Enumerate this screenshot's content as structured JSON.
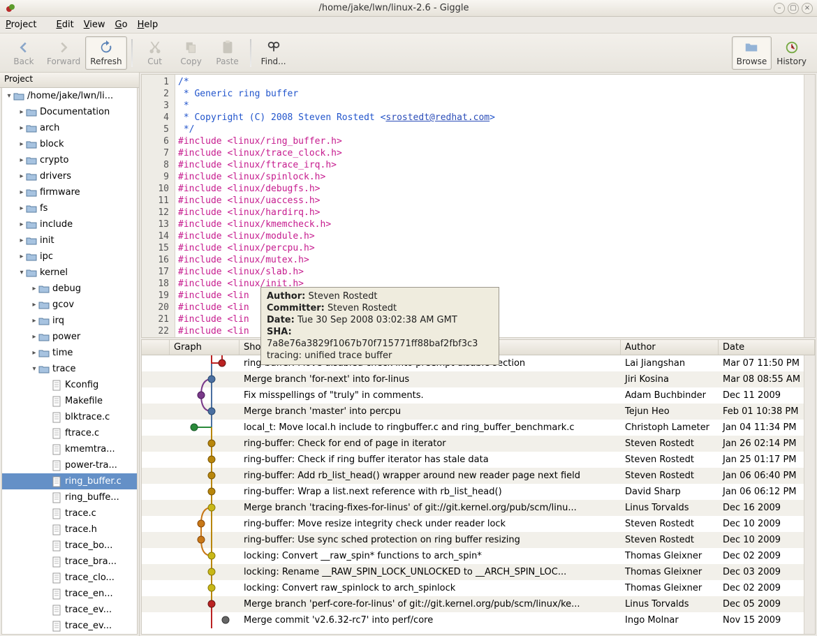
{
  "window": {
    "title": "/home/jake/lwn/linux-2.6 - Giggle"
  },
  "menu": {
    "project": "Project",
    "edit": "Edit",
    "view": "View",
    "go": "Go",
    "help": "Help"
  },
  "toolbar": {
    "back": "Back",
    "forward": "Forward",
    "refresh": "Refresh",
    "cut": "Cut",
    "copy": "Copy",
    "paste": "Paste",
    "find": "Find...",
    "browse": "Browse",
    "history": "History"
  },
  "sidebar": {
    "header": "Project",
    "tree": [
      {
        "depth": 0,
        "exp": "▾",
        "icon": "folder",
        "label": "/home/jake/lwn/li..."
      },
      {
        "depth": 1,
        "exp": "▸",
        "icon": "folder",
        "label": "Documentation"
      },
      {
        "depth": 1,
        "exp": "▸",
        "icon": "folder",
        "label": "arch"
      },
      {
        "depth": 1,
        "exp": "▸",
        "icon": "folder",
        "label": "block"
      },
      {
        "depth": 1,
        "exp": "▸",
        "icon": "folder",
        "label": "crypto"
      },
      {
        "depth": 1,
        "exp": "▸",
        "icon": "folder",
        "label": "drivers"
      },
      {
        "depth": 1,
        "exp": "▸",
        "icon": "folder",
        "label": "firmware"
      },
      {
        "depth": 1,
        "exp": "▸",
        "icon": "folder",
        "label": "fs"
      },
      {
        "depth": 1,
        "exp": "▸",
        "icon": "folder",
        "label": "include"
      },
      {
        "depth": 1,
        "exp": "▸",
        "icon": "folder",
        "label": "init"
      },
      {
        "depth": 1,
        "exp": "▸",
        "icon": "folder",
        "label": "ipc"
      },
      {
        "depth": 1,
        "exp": "▾",
        "icon": "folder",
        "label": "kernel"
      },
      {
        "depth": 2,
        "exp": "▸",
        "icon": "folder",
        "label": "debug"
      },
      {
        "depth": 2,
        "exp": "▸",
        "icon": "folder",
        "label": "gcov"
      },
      {
        "depth": 2,
        "exp": "▸",
        "icon": "folder",
        "label": "irq"
      },
      {
        "depth": 2,
        "exp": "▸",
        "icon": "folder",
        "label": "power"
      },
      {
        "depth": 2,
        "exp": "▸",
        "icon": "folder",
        "label": "time"
      },
      {
        "depth": 2,
        "exp": "▾",
        "icon": "folder",
        "label": "trace"
      },
      {
        "depth": 3,
        "exp": "",
        "icon": "file",
        "label": "Kconfig"
      },
      {
        "depth": 3,
        "exp": "",
        "icon": "file",
        "label": "Makefile"
      },
      {
        "depth": 3,
        "exp": "",
        "icon": "file",
        "label": "blktrace.c"
      },
      {
        "depth": 3,
        "exp": "",
        "icon": "file",
        "label": "ftrace.c"
      },
      {
        "depth": 3,
        "exp": "",
        "icon": "file",
        "label": "kmemtra..."
      },
      {
        "depth": 3,
        "exp": "",
        "icon": "file",
        "label": "power-tra..."
      },
      {
        "depth": 3,
        "exp": "",
        "icon": "file",
        "label": "ring_buffer.c",
        "selected": true
      },
      {
        "depth": 3,
        "exp": "",
        "icon": "file",
        "label": "ring_buffe..."
      },
      {
        "depth": 3,
        "exp": "",
        "icon": "file",
        "label": "trace.c"
      },
      {
        "depth": 3,
        "exp": "",
        "icon": "file",
        "label": "trace.h"
      },
      {
        "depth": 3,
        "exp": "",
        "icon": "file",
        "label": "trace_bo..."
      },
      {
        "depth": 3,
        "exp": "",
        "icon": "file",
        "label": "trace_bra..."
      },
      {
        "depth": 3,
        "exp": "",
        "icon": "file",
        "label": "trace_clo..."
      },
      {
        "depth": 3,
        "exp": "",
        "icon": "file",
        "label": "trace_en..."
      },
      {
        "depth": 3,
        "exp": "",
        "icon": "file",
        "label": "trace_ev..."
      },
      {
        "depth": 3,
        "exp": "",
        "icon": "file",
        "label": "trace_ev..."
      }
    ]
  },
  "code": {
    "lines": [
      {
        "n": 1,
        "cls": "tok-comment",
        "t": "/*"
      },
      {
        "n": 2,
        "cls": "tok-comment",
        "t": " * Generic ring buffer"
      },
      {
        "n": 3,
        "cls": "tok-comment",
        "t": " *"
      },
      {
        "n": 4,
        "cls": "tok-comment",
        "t": " * Copyright (C) 2008 Steven Rostedt <",
        "link": "srostedt@redhat.com",
        "tail": ">"
      },
      {
        "n": 5,
        "cls": "tok-comment",
        "t": " */"
      },
      {
        "n": 6,
        "cls": "tok-inc",
        "t": "#include <linux/ring_buffer.h>"
      },
      {
        "n": 7,
        "cls": "tok-inc",
        "t": "#include <linux/trace_clock.h>"
      },
      {
        "n": 8,
        "cls": "tok-inc",
        "t": "#include <linux/ftrace_irq.h>"
      },
      {
        "n": 9,
        "cls": "tok-inc",
        "t": "#include <linux/spinlock.h>"
      },
      {
        "n": 10,
        "cls": "tok-inc",
        "t": "#include <linux/debugfs.h>"
      },
      {
        "n": 11,
        "cls": "tok-inc",
        "t": "#include <linux/uaccess.h>"
      },
      {
        "n": 12,
        "cls": "tok-inc",
        "t": "#include <linux/hardirq.h>"
      },
      {
        "n": 13,
        "cls": "tok-inc",
        "t": "#include <linux/kmemcheck.h>"
      },
      {
        "n": 14,
        "cls": "tok-inc",
        "t": "#include <linux/module.h>"
      },
      {
        "n": 15,
        "cls": "tok-inc",
        "t": "#include <linux/percpu.h>"
      },
      {
        "n": 16,
        "cls": "tok-inc",
        "t": "#include <linux/mutex.h>"
      },
      {
        "n": 17,
        "cls": "tok-inc",
        "t": "#include <linux/slab.h>"
      },
      {
        "n": 18,
        "cls": "tok-inc",
        "t": "#include <linux/init.h>"
      },
      {
        "n": 19,
        "cls": "tok-inc",
        "t": "#include <lin"
      },
      {
        "n": 20,
        "cls": "tok-inc",
        "t": "#include <lin"
      },
      {
        "n": 21,
        "cls": "tok-inc",
        "t": "#include <lin"
      },
      {
        "n": 22,
        "cls": "tok-inc",
        "t": "#include <lin"
      }
    ]
  },
  "tooltip": {
    "author_label": "Author:",
    "author": "Steven Rostedt",
    "committer_label": "Committer:",
    "committer": "Steven Rostedt",
    "date_label": "Date:",
    "date": "Tue 30 Sep 2008 03:02:38 AM GMT",
    "sha_label": "SHA:",
    "sha": "7a8e76a3829f1067b70f715771ff88baf2fbf3c3",
    "msg": "tracing: unified trace buffer"
  },
  "commits": {
    "headers": {
      "graph": "Graph",
      "log": "Short Log",
      "author": "Author",
      "date": "Date"
    },
    "rows": [
      {
        "log": "ring-buffer: Move disabled check into preempt disable section",
        "author": "Lai Jiangshan",
        "date": "Mar 07 11:50 PM"
      },
      {
        "log": "Merge branch 'for-next' into for-linus",
        "author": "Jiri Kosina",
        "date": "Mar 08 08:55 AM"
      },
      {
        "log": "Fix misspellings of \"truly\" in comments.",
        "author": "Adam Buchbinder",
        "date": "Dec 11 2009"
      },
      {
        "log": "Merge branch 'master' into percpu",
        "author": "Tejun Heo",
        "date": "Feb 01 10:38 PM"
      },
      {
        "log": "local_t: Move local.h include to ringbuffer.c and ring_buffer_benchmark.c",
        "author": "Christoph Lameter",
        "date": "Jan 04 11:34 PM"
      },
      {
        "log": "ring-buffer: Check for end of page in iterator",
        "author": "Steven Rostedt",
        "date": "Jan 26 02:14 PM"
      },
      {
        "log": "ring-buffer: Check if ring buffer iterator has stale data",
        "author": "Steven Rostedt",
        "date": "Jan 25 01:17 PM"
      },
      {
        "log": "ring-buffer: Add rb_list_head() wrapper around new reader page next field",
        "author": "Steven Rostedt",
        "date": "Jan 06 06:40 PM"
      },
      {
        "log": "ring-buffer: Wrap a list.next reference with rb_list_head()",
        "author": "David Sharp",
        "date": "Jan 06 06:12 PM"
      },
      {
        "log": "Merge branch 'tracing-fixes-for-linus' of git://git.kernel.org/pub/scm/linu...",
        "author": "Linus Torvalds",
        "date": "Dec 16 2009"
      },
      {
        "log": "ring-buffer: Move resize integrity check under reader lock",
        "author": "Steven Rostedt",
        "date": "Dec 10 2009"
      },
      {
        "log": "ring-buffer: Use sync sched protection on ring buffer resizing",
        "author": "Steven Rostedt",
        "date": "Dec 10 2009"
      },
      {
        "log": "locking: Convert __raw_spin* functions to arch_spin*",
        "author": "Thomas Gleixner",
        "date": "Dec 02 2009"
      },
      {
        "log": "locking: Rename __RAW_SPIN_LOCK_UNLOCKED to __ARCH_SPIN_LOC...",
        "author": "Thomas Gleixner",
        "date": "Dec 03 2009"
      },
      {
        "log": "locking: Convert raw_spinlock to arch_spinlock",
        "author": "Thomas Gleixner",
        "date": "Dec 02 2009"
      },
      {
        "log": "Merge branch 'perf-core-for-linus' of git://git.kernel.org/pub/scm/linux/ke...",
        "author": "Linus Torvalds",
        "date": "Dec 05 2009"
      },
      {
        "log": "Merge commit 'v2.6.32-rc7' into perf/core",
        "author": "Ingo Molnar",
        "date": "Nov 15 2009"
      }
    ]
  }
}
